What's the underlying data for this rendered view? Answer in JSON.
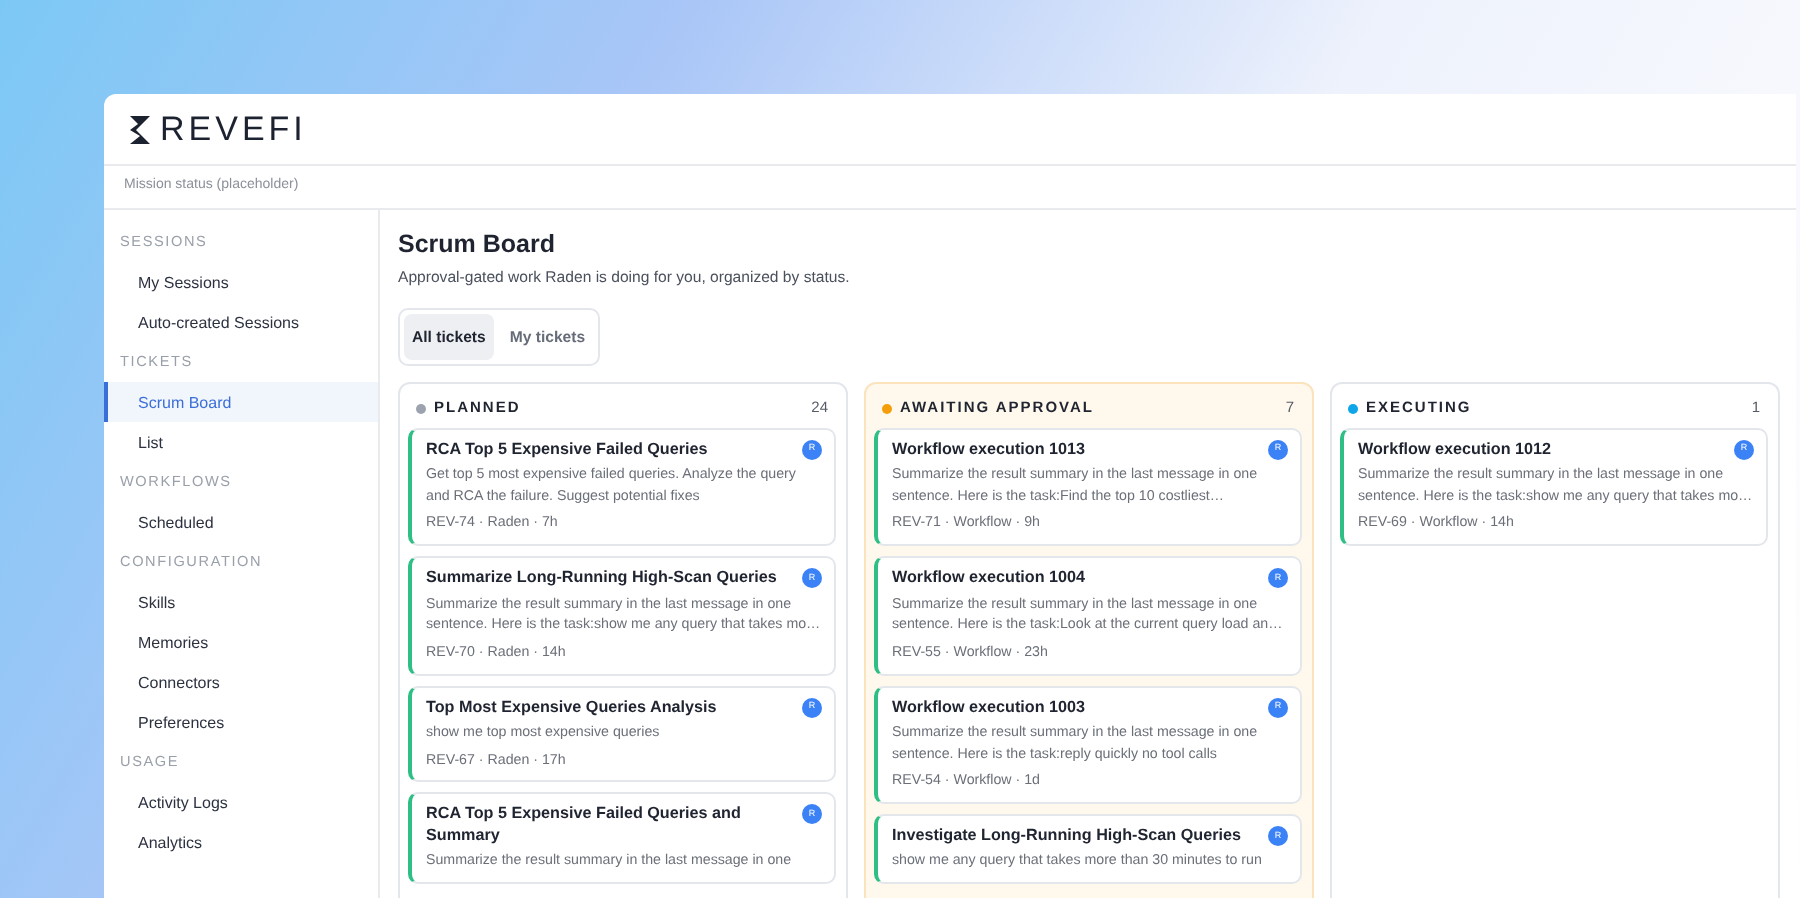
{
  "brand": {
    "name": "REVEFI"
  },
  "mission_status": "Mission status (placeholder)",
  "sidebar": {
    "sections": [
      {
        "title": "SESSIONS",
        "items": [
          {
            "label": "My Sessions",
            "selected": false
          },
          {
            "label": "Auto-created Sessions",
            "selected": false
          }
        ]
      },
      {
        "title": "TICKETS",
        "items": [
          {
            "label": "Scrum Board",
            "selected": true
          },
          {
            "label": "List",
            "selected": false
          }
        ]
      },
      {
        "title": "WORKFLOWS",
        "items": [
          {
            "label": "Scheduled",
            "selected": false
          }
        ]
      },
      {
        "title": "CONFIGURATION",
        "items": [
          {
            "label": "Skills",
            "selected": false
          },
          {
            "label": "Memories",
            "selected": false
          },
          {
            "label": "Connectors",
            "selected": false
          },
          {
            "label": "Preferences",
            "selected": false
          }
        ]
      },
      {
        "title": "USAGE",
        "items": [
          {
            "label": "Activity Logs",
            "selected": false
          },
          {
            "label": "Analytics",
            "selected": false
          }
        ]
      }
    ]
  },
  "page": {
    "title": "Scrum Board",
    "subtitle": "Approval-gated work Raden is doing for you, organized by status."
  },
  "tabs": [
    {
      "label": "All tickets",
      "selected": true
    },
    {
      "label": "My tickets",
      "selected": false
    }
  ],
  "columns": [
    {
      "title": "PLANNED",
      "count": "24",
      "color": "#9ca3af",
      "highlighted": false,
      "cards": [
        {
          "title": "RCA Top 5 Expensive Failed Queries",
          "avatar": "R",
          "description": "Get top 5 most expensive failed queries. Analyze the query and RCA the failure. Suggest potential fixes",
          "meta": "REV-74 · Raden · 7h"
        },
        {
          "title": "Summarize Long-Running High-Scan Queries",
          "avatar": "R",
          "description": "Summarize the result summary in the last message in one sentence. Here is the task:show me any query that takes mo…",
          "meta": "REV-70 · Raden · 14h"
        },
        {
          "title": "Top Most Expensive Queries Analysis",
          "avatar": "R",
          "description": "show me top most expensive queries",
          "meta": "REV-67 · Raden · 17h"
        },
        {
          "title": "RCA Top 5 Expensive Failed Queries and Summary",
          "avatar": "R",
          "description": "Summarize the result summary in the last message in one"
        }
      ]
    },
    {
      "title": "AWAITING APPROVAL",
      "count": "7",
      "color": "#f59e0b",
      "highlighted": true,
      "cards": [
        {
          "title": "Workflow execution 1013",
          "avatar": "R",
          "description": "Summarize the result summary in the last message in one sentence. Here is the task:Find the top 10 costliest…",
          "meta": "REV-71 · Workflow · 9h"
        },
        {
          "title": "Workflow execution 1004",
          "avatar": "R",
          "description": "Summarize the result summary in the last message in one sentence. Here is the task:Look at the current query load an…",
          "meta": "REV-55 · Workflow · 23h"
        },
        {
          "title": "Workflow execution 1003",
          "avatar": "R",
          "description": "Summarize the result summary in the last message in one sentence. Here is the task:reply quickly no tool calls",
          "meta": "REV-54 · Workflow · 1d"
        },
        {
          "title": "Investigate Long-Running High-Scan Queries",
          "avatar": "R",
          "description": "show me any query that takes more than 30 minutes to run"
        }
      ]
    },
    {
      "title": "EXECUTING",
      "count": "1",
      "color": "#0ea5e9",
      "highlighted": false,
      "cards": [
        {
          "title": "Workflow execution 1012",
          "avatar": "R",
          "description": "Summarize the result summary in the last message in one sentence. Here is the task:show me any query that takes mo…",
          "meta": "REV-69 · Workflow · 14h"
        }
      ]
    }
  ]
}
